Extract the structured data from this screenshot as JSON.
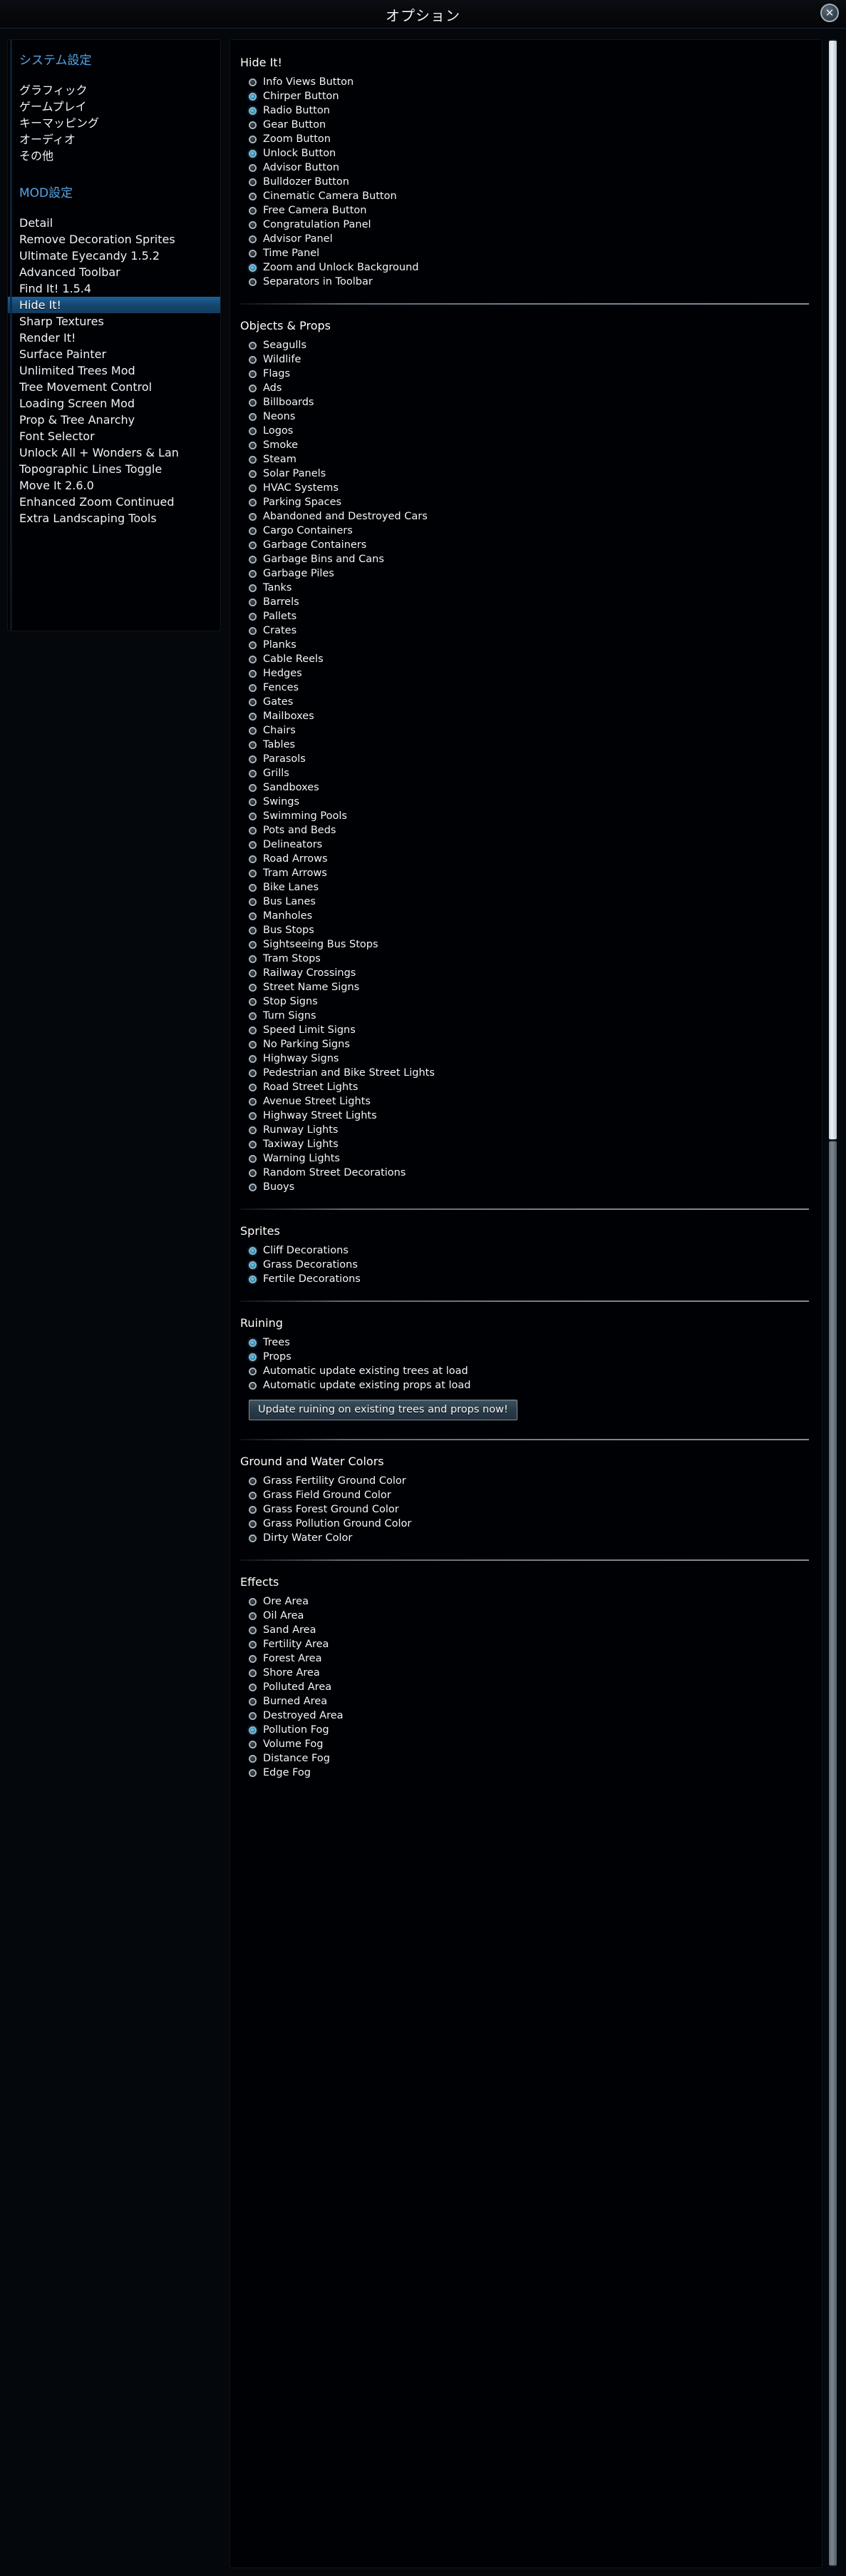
{
  "window": {
    "title": "オプション",
    "close_label": "✕"
  },
  "sidebar": {
    "system_heading": "システム設定",
    "system_items": [
      "グラフィック",
      "ゲームプレイ",
      "キーマッピング",
      "オーディオ",
      "その他"
    ],
    "mod_heading": "MOD設定",
    "mod_items": [
      "Detail",
      "Remove Decoration Sprites",
      "Ultimate Eyecandy 1.5.2",
      "Advanced Toolbar",
      "Find It! 1.5.4",
      "Hide It!",
      "Sharp Textures",
      "Render It!",
      "Surface Painter",
      "Unlimited Trees Mod",
      "Tree Movement Control",
      "Loading Screen Mod",
      "Prop & Tree Anarchy",
      "Font Selector",
      "Unlock All + Wonders & Lan",
      "Topographic Lines Toggle",
      "Move It 2.6.0",
      "Enhanced Zoom Continued",
      "Extra Landscaping Tools"
    ],
    "selected_mod": "Hide It!"
  },
  "accent_color": "#2bb7e9",
  "highlight_color": "#1f5f9c",
  "main": {
    "groups": [
      {
        "title": "Hide It!",
        "options": [
          {
            "label": "Info Views Button",
            "checked": false
          },
          {
            "label": "Chirper Button",
            "checked": true
          },
          {
            "label": "Radio Button",
            "checked": true
          },
          {
            "label": "Gear Button",
            "checked": false
          },
          {
            "label": "Zoom Button",
            "checked": false
          },
          {
            "label": "Unlock Button",
            "checked": true
          },
          {
            "label": "Advisor Button",
            "checked": false
          },
          {
            "label": "Bulldozer Button",
            "checked": false
          },
          {
            "label": "Cinematic Camera Button",
            "checked": false
          },
          {
            "label": "Free Camera Button",
            "checked": false
          },
          {
            "label": "Congratulation Panel",
            "checked": false
          },
          {
            "label": "Advisor Panel",
            "checked": false
          },
          {
            "label": "Time Panel",
            "checked": false
          },
          {
            "label": "Zoom and Unlock Background",
            "checked": true
          },
          {
            "label": "Separators in Toolbar",
            "checked": false
          }
        ]
      },
      {
        "title": "Objects & Props",
        "options": [
          {
            "label": "Seagulls",
            "checked": false
          },
          {
            "label": "Wildlife",
            "checked": false
          },
          {
            "label": "Flags",
            "checked": false
          },
          {
            "label": "Ads",
            "checked": false
          },
          {
            "label": "Billboards",
            "checked": false
          },
          {
            "label": "Neons",
            "checked": false
          },
          {
            "label": "Logos",
            "checked": false
          },
          {
            "label": "Smoke",
            "checked": false
          },
          {
            "label": "Steam",
            "checked": false
          },
          {
            "label": "Solar Panels",
            "checked": false
          },
          {
            "label": "HVAC Systems",
            "checked": false
          },
          {
            "label": "Parking Spaces",
            "checked": false
          },
          {
            "label": "Abandoned and Destroyed Cars",
            "checked": false
          },
          {
            "label": "Cargo Containers",
            "checked": false
          },
          {
            "label": "Garbage Containers",
            "checked": false
          },
          {
            "label": "Garbage Bins and Cans",
            "checked": false
          },
          {
            "label": "Garbage Piles",
            "checked": false
          },
          {
            "label": "Tanks",
            "checked": false
          },
          {
            "label": "Barrels",
            "checked": false
          },
          {
            "label": "Pallets",
            "checked": false
          },
          {
            "label": "Crates",
            "checked": false
          },
          {
            "label": "Planks",
            "checked": false
          },
          {
            "label": "Cable Reels",
            "checked": false
          },
          {
            "label": "Hedges",
            "checked": false
          },
          {
            "label": "Fences",
            "checked": false
          },
          {
            "label": "Gates",
            "checked": false
          },
          {
            "label": "Mailboxes",
            "checked": false
          },
          {
            "label": "Chairs",
            "checked": false
          },
          {
            "label": "Tables",
            "checked": false
          },
          {
            "label": "Parasols",
            "checked": false
          },
          {
            "label": "Grills",
            "checked": false
          },
          {
            "label": "Sandboxes",
            "checked": false
          },
          {
            "label": "Swings",
            "checked": false
          },
          {
            "label": "Swimming Pools",
            "checked": false
          },
          {
            "label": "Pots and Beds",
            "checked": false
          },
          {
            "label": "Delineators",
            "checked": false
          },
          {
            "label": "Road Arrows",
            "checked": false
          },
          {
            "label": "Tram Arrows",
            "checked": false
          },
          {
            "label": "Bike Lanes",
            "checked": false
          },
          {
            "label": "Bus Lanes",
            "checked": false
          },
          {
            "label": "Manholes",
            "checked": false
          },
          {
            "label": "Bus Stops",
            "checked": false
          },
          {
            "label": "Sightseeing Bus Stops",
            "checked": false
          },
          {
            "label": "Tram Stops",
            "checked": false
          },
          {
            "label": "Railway Crossings",
            "checked": false
          },
          {
            "label": "Street Name Signs",
            "checked": false
          },
          {
            "label": "Stop Signs",
            "checked": false
          },
          {
            "label": "Turn Signs",
            "checked": false
          },
          {
            "label": "Speed Limit Signs",
            "checked": false
          },
          {
            "label": "No Parking Signs",
            "checked": false
          },
          {
            "label": "Highway Signs",
            "checked": false
          },
          {
            "label": "Pedestrian and Bike Street Lights",
            "checked": false
          },
          {
            "label": "Road Street Lights",
            "checked": false
          },
          {
            "label": "Avenue Street Lights",
            "checked": false
          },
          {
            "label": "Highway Street Lights",
            "checked": false
          },
          {
            "label": "Runway Lights",
            "checked": false
          },
          {
            "label": "Taxiway Lights",
            "checked": false
          },
          {
            "label": "Warning Lights",
            "checked": false
          },
          {
            "label": "Random Street Decorations",
            "checked": false
          },
          {
            "label": "Buoys",
            "checked": false
          }
        ]
      },
      {
        "title": "Sprites",
        "options": [
          {
            "label": "Cliff Decorations",
            "checked": true
          },
          {
            "label": "Grass Decorations",
            "checked": true
          },
          {
            "label": "Fertile Decorations",
            "checked": true
          }
        ]
      },
      {
        "title": "Ruining",
        "options": [
          {
            "label": "Trees",
            "checked": true
          },
          {
            "label": "Props",
            "checked": true
          },
          {
            "label": "Automatic update existing trees at load",
            "checked": false
          },
          {
            "label": "Automatic update existing props at load",
            "checked": false
          }
        ],
        "button": "Update ruining on existing trees and props now!"
      },
      {
        "title": "Ground and Water Colors",
        "options": [
          {
            "label": "Grass Fertility Ground Color",
            "checked": false
          },
          {
            "label": "Grass Field Ground Color",
            "checked": false
          },
          {
            "label": "Grass Forest Ground Color",
            "checked": false
          },
          {
            "label": "Grass Pollution Ground Color",
            "checked": false
          },
          {
            "label": "Dirty Water Color",
            "checked": false
          }
        ]
      },
      {
        "title": "Effects",
        "options": [
          {
            "label": "Ore Area",
            "checked": false
          },
          {
            "label": "Oil Area",
            "checked": false
          },
          {
            "label": "Sand Area",
            "checked": false
          },
          {
            "label": "Fertility Area",
            "checked": false
          },
          {
            "label": "Forest Area",
            "checked": false
          },
          {
            "label": "Shore Area",
            "checked": false
          },
          {
            "label": "Polluted Area",
            "checked": false
          },
          {
            "label": "Burned Area",
            "checked": false
          },
          {
            "label": "Destroyed Area",
            "checked": false
          },
          {
            "label": "Pollution Fog",
            "checked": true
          },
          {
            "label": "Volume Fog",
            "checked": false
          },
          {
            "label": "Distance Fog",
            "checked": false
          },
          {
            "label": "Edge Fog",
            "checked": false
          }
        ]
      }
    ]
  }
}
